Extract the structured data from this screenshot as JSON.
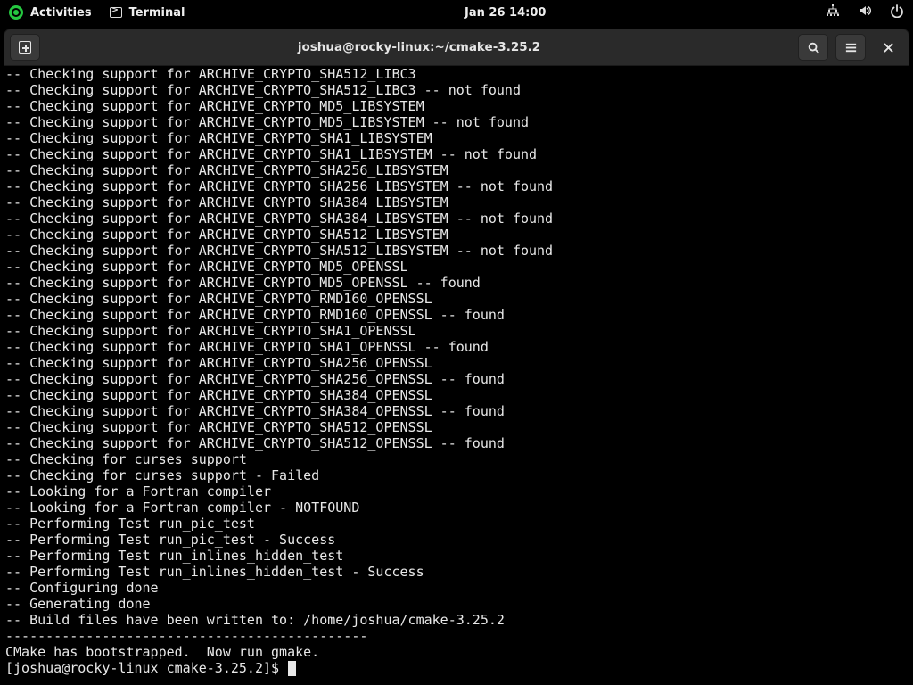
{
  "topbar": {
    "activities": "Activities",
    "app_label": "Terminal",
    "clock": "Jan 26  14:00"
  },
  "headerbar": {
    "title": "joshua@rocky-linux:~/cmake-3.25.2"
  },
  "terminal": {
    "lines": [
      "-- Checking support for ARCHIVE_CRYPTO_SHA512_LIBC3",
      "-- Checking support for ARCHIVE_CRYPTO_SHA512_LIBC3 -- not found",
      "-- Checking support for ARCHIVE_CRYPTO_MD5_LIBSYSTEM",
      "-- Checking support for ARCHIVE_CRYPTO_MD5_LIBSYSTEM -- not found",
      "-- Checking support for ARCHIVE_CRYPTO_SHA1_LIBSYSTEM",
      "-- Checking support for ARCHIVE_CRYPTO_SHA1_LIBSYSTEM -- not found",
      "-- Checking support for ARCHIVE_CRYPTO_SHA256_LIBSYSTEM",
      "-- Checking support for ARCHIVE_CRYPTO_SHA256_LIBSYSTEM -- not found",
      "-- Checking support for ARCHIVE_CRYPTO_SHA384_LIBSYSTEM",
      "-- Checking support for ARCHIVE_CRYPTO_SHA384_LIBSYSTEM -- not found",
      "-- Checking support for ARCHIVE_CRYPTO_SHA512_LIBSYSTEM",
      "-- Checking support for ARCHIVE_CRYPTO_SHA512_LIBSYSTEM -- not found",
      "-- Checking support for ARCHIVE_CRYPTO_MD5_OPENSSL",
      "-- Checking support for ARCHIVE_CRYPTO_MD5_OPENSSL -- found",
      "-- Checking support for ARCHIVE_CRYPTO_RMD160_OPENSSL",
      "-- Checking support for ARCHIVE_CRYPTO_RMD160_OPENSSL -- found",
      "-- Checking support for ARCHIVE_CRYPTO_SHA1_OPENSSL",
      "-- Checking support for ARCHIVE_CRYPTO_SHA1_OPENSSL -- found",
      "-- Checking support for ARCHIVE_CRYPTO_SHA256_OPENSSL",
      "-- Checking support for ARCHIVE_CRYPTO_SHA256_OPENSSL -- found",
      "-- Checking support for ARCHIVE_CRYPTO_SHA384_OPENSSL",
      "-- Checking support for ARCHIVE_CRYPTO_SHA384_OPENSSL -- found",
      "-- Checking support for ARCHIVE_CRYPTO_SHA512_OPENSSL",
      "-- Checking support for ARCHIVE_CRYPTO_SHA512_OPENSSL -- found",
      "-- Checking for curses support",
      "-- Checking for curses support - Failed",
      "-- Looking for a Fortran compiler",
      "-- Looking for a Fortran compiler - NOTFOUND",
      "-- Performing Test run_pic_test",
      "-- Performing Test run_pic_test - Success",
      "-- Performing Test run_inlines_hidden_test",
      "-- Performing Test run_inlines_hidden_test - Success",
      "-- Configuring done",
      "-- Generating done",
      "-- Build files have been written to: /home/joshua/cmake-3.25.2",
      "---------------------------------------------",
      "CMake has bootstrapped.  Now run gmake."
    ],
    "prompt": "[joshua@rocky-linux cmake-3.25.2]$ "
  }
}
